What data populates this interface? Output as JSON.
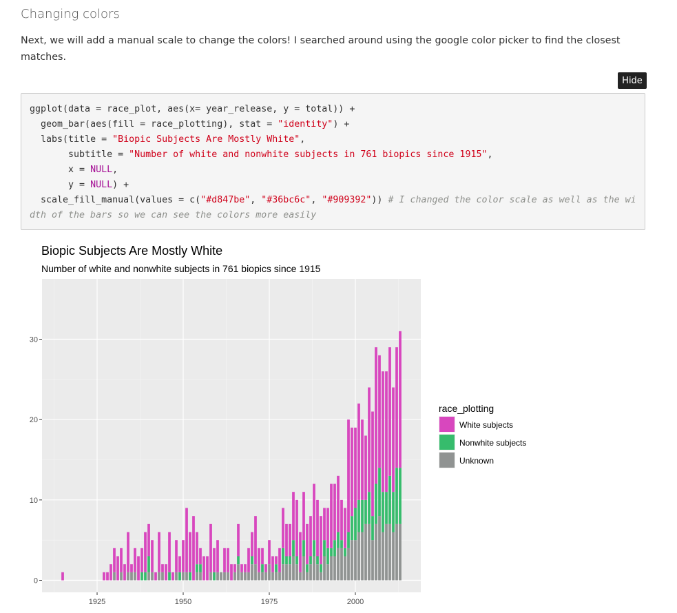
{
  "section": {
    "heading": "Changing colors",
    "intro": "Next, we will add a manual scale to change the colors! I searched around using the google color picker to find the closest matches."
  },
  "code": {
    "toggle_label": "Hide",
    "lines": [
      [
        {
          "t": "ggplot(data = race_plot, aes(x= year_release, y = total)) +",
          "c": ""
        }
      ],
      [
        {
          "t": "  geom_bar(aes(fill = race_plotting), stat = ",
          "c": ""
        },
        {
          "t": "\"identity\"",
          "c": "str"
        },
        {
          "t": ") +",
          "c": ""
        }
      ],
      [
        {
          "t": "  labs(title = ",
          "c": ""
        },
        {
          "t": "\"Biopic Subjects Are Mostly White\"",
          "c": "str"
        },
        {
          "t": ",",
          "c": ""
        }
      ],
      [
        {
          "t": "       subtitle = ",
          "c": ""
        },
        {
          "t": "\"Number of white and nonwhite subjects in 761 biopics since 1915\"",
          "c": "str"
        },
        {
          "t": ",",
          "c": ""
        }
      ],
      [
        {
          "t": "       x = ",
          "c": ""
        },
        {
          "t": "NULL",
          "c": "kw"
        },
        {
          "t": ",",
          "c": ""
        }
      ],
      [
        {
          "t": "       y = ",
          "c": ""
        },
        {
          "t": "NULL",
          "c": "kw"
        },
        {
          "t": ") +",
          "c": ""
        }
      ],
      [
        {
          "t": "  scale_fill_manual(values = c(",
          "c": ""
        },
        {
          "t": "\"#d847be\"",
          "c": "str"
        },
        {
          "t": ", ",
          "c": ""
        },
        {
          "t": "\"#36bc6c\"",
          "c": "str"
        },
        {
          "t": ", ",
          "c": ""
        },
        {
          "t": "\"#909392\"",
          "c": "str"
        },
        {
          "t": ")) ",
          "c": ""
        },
        {
          "t": "# I changed the color scale as well as the width of the bars so we can see the colors more easily",
          "c": "cm"
        }
      ]
    ]
  },
  "chart_data": {
    "type": "bar",
    "stacked": true,
    "title": "Biopic Subjects Are Mostly White",
    "subtitle": "Number of white and nonwhite subjects in 761 biopics since 1915",
    "xlabel": "",
    "ylabel": "",
    "xlim": [
      1909,
      2019
    ],
    "ylim": [
      -1.5,
      37.5
    ],
    "x_ticks": [
      1925,
      1950,
      1975,
      2000
    ],
    "y_ticks": [
      0,
      10,
      20,
      30
    ],
    "grid": true,
    "legend_position": "right",
    "legend_title": "race_plotting",
    "series": [
      {
        "name": "White subjects",
        "color": "#d847be",
        "values": [
          1,
          0,
          0,
          0,
          0,
          0,
          0,
          0,
          0,
          0,
          0,
          0,
          1,
          1,
          2,
          3,
          3,
          3,
          2,
          5,
          1,
          3,
          3,
          3,
          5,
          4,
          4,
          1,
          5,
          1,
          2,
          5,
          1,
          4,
          2,
          4,
          8,
          5,
          8,
          4,
          2,
          3,
          3,
          6,
          3,
          4,
          0,
          3,
          3,
          2,
          1,
          4,
          1,
          1,
          3,
          3,
          6,
          3,
          2,
          1,
          3,
          2,
          1,
          3,
          5,
          4,
          4,
          6,
          7,
          5,
          6,
          5,
          5,
          7,
          7,
          6,
          4,
          5,
          8,
          7,
          7,
          5,
          5,
          14,
          11,
          10,
          12,
          10,
          8,
          13,
          13,
          17,
          14,
          15,
          15,
          16,
          13,
          15,
          17
        ]
      },
      {
        "name": "Nonwhite subjects",
        "color": "#36bc6c",
        "values": [
          0,
          0,
          0,
          0,
          0,
          0,
          0,
          0,
          0,
          0,
          0,
          0,
          0,
          0,
          0,
          0,
          0,
          0,
          0,
          0,
          0,
          0,
          0,
          1,
          1,
          2,
          0,
          0,
          0,
          0,
          0,
          1,
          0,
          0,
          1,
          0,
          0,
          1,
          0,
          1,
          1,
          0,
          0,
          0,
          1,
          0,
          0,
          0,
          0,
          0,
          0,
          1,
          0,
          0,
          0,
          1,
          0,
          0,
          1,
          0,
          0,
          0,
          1,
          0,
          2,
          1,
          1,
          2,
          1,
          0,
          2,
          1,
          1,
          2,
          1,
          1,
          2,
          2,
          1,
          2,
          2,
          1,
          1,
          2,
          3,
          4,
          4,
          4,
          3,
          4,
          3,
          5,
          6,
          5,
          4,
          6,
          5,
          7,
          7
        ]
      },
      {
        "name": "Unknown",
        "color": "#909392",
        "values": [
          0,
          0,
          0,
          0,
          0,
          0,
          0,
          0,
          0,
          0,
          0,
          0,
          0,
          0,
          0,
          1,
          0,
          1,
          0,
          1,
          1,
          1,
          0,
          0,
          0,
          1,
          1,
          0,
          1,
          1,
          0,
          0,
          0,
          1,
          0,
          1,
          1,
          0,
          0,
          1,
          1,
          0,
          0,
          1,
          0,
          1,
          1,
          1,
          1,
          0,
          1,
          2,
          1,
          1,
          1,
          2,
          2,
          1,
          1,
          1,
          2,
          1,
          1,
          1,
          2,
          2,
          2,
          3,
          2,
          1,
          3,
          1,
          2,
          3,
          2,
          1,
          3,
          2,
          3,
          3,
          4,
          4,
          3,
          4,
          5,
          5,
          6,
          6,
          7,
          7,
          5,
          7,
          8,
          6,
          7,
          7,
          6,
          7,
          7
        ]
      }
    ],
    "x": [
      1915,
      1916,
      1917,
      1918,
      1919,
      1920,
      1921,
      1922,
      1923,
      1924,
      1925,
      1926,
      1927,
      1928,
      1929,
      1930,
      1931,
      1932,
      1933,
      1934,
      1935,
      1936,
      1937,
      1938,
      1939,
      1940,
      1941,
      1942,
      1943,
      1944,
      1945,
      1946,
      1947,
      1948,
      1949,
      1950,
      1951,
      1952,
      1953,
      1954,
      1955,
      1956,
      1957,
      1958,
      1959,
      1960,
      1961,
      1962,
      1963,
      1964,
      1965,
      1966,
      1967,
      1968,
      1969,
      1970,
      1971,
      1972,
      1973,
      1974,
      1975,
      1976,
      1977,
      1978,
      1979,
      1980,
      1981,
      1982,
      1983,
      1984,
      1985,
      1986,
      1987,
      1988,
      1989,
      1990,
      1991,
      1992,
      1993,
      1994,
      1995,
      1996,
      1997,
      1998,
      1999,
      2000,
      2001,
      2002,
      2003,
      2004,
      2005,
      2006,
      2007,
      2008,
      2009,
      2010,
      2011,
      2012,
      2013
    ]
  }
}
